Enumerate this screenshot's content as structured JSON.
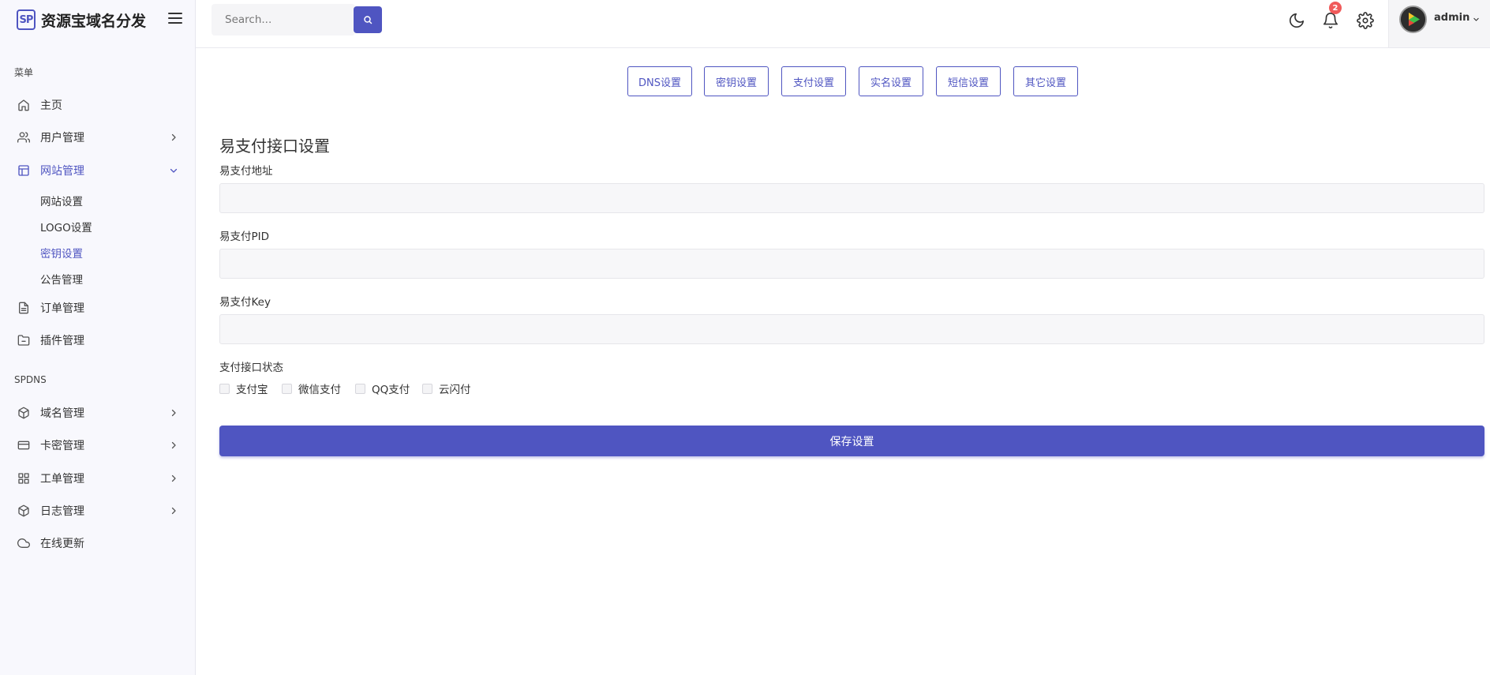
{
  "brand": {
    "logo_text": "SP",
    "name": "资源宝域名分发"
  },
  "sidebar": {
    "heading_menu": "菜单",
    "heading_spdns": "SPDNS",
    "items": [
      {
        "label": "主页",
        "icon": "home-icon"
      },
      {
        "label": "用户管理",
        "icon": "users-icon"
      },
      {
        "label": "网站管理",
        "icon": "layout-icon"
      },
      {
        "label": "订单管理",
        "icon": "file-icon"
      },
      {
        "label": "插件管理",
        "icon": "folder-icon"
      },
      {
        "label": "域名管理",
        "icon": "box-icon"
      },
      {
        "label": "卡密管理",
        "icon": "card-icon"
      },
      {
        "label": "工单管理",
        "icon": "grid-icon"
      },
      {
        "label": "日志管理",
        "icon": "box-icon"
      },
      {
        "label": "在线更新",
        "icon": "cloud-icon"
      }
    ],
    "sub_items": [
      {
        "label": "网站设置"
      },
      {
        "label": "LOGO设置"
      },
      {
        "label": "密钥设置"
      },
      {
        "label": "公告管理"
      }
    ]
  },
  "header": {
    "search_placeholder": "Search...",
    "notification_count": "2",
    "username": "admin"
  },
  "tabs": [
    {
      "label": "DNS设置"
    },
    {
      "label": "密钥设置"
    },
    {
      "label": "支付设置"
    },
    {
      "label": "实名设置"
    },
    {
      "label": "短信设置"
    },
    {
      "label": "其它设置"
    }
  ],
  "form": {
    "title": "易支付接口设置",
    "fields": [
      {
        "label": "易支付地址",
        "value": ""
      },
      {
        "label": "易支付PID",
        "value": ""
      },
      {
        "label": "易支付Key",
        "value": ""
      }
    ],
    "status_label": "支付接口状态",
    "options": [
      {
        "label": "支付宝",
        "checked": false
      },
      {
        "label": "微信支付",
        "checked": false
      },
      {
        "label": "QQ支付",
        "checked": false
      },
      {
        "label": "云闪付",
        "checked": false
      }
    ],
    "save_label": "保存设置"
  },
  "colors": {
    "accent": "#4f55c1",
    "badge": "#f05a5a"
  }
}
